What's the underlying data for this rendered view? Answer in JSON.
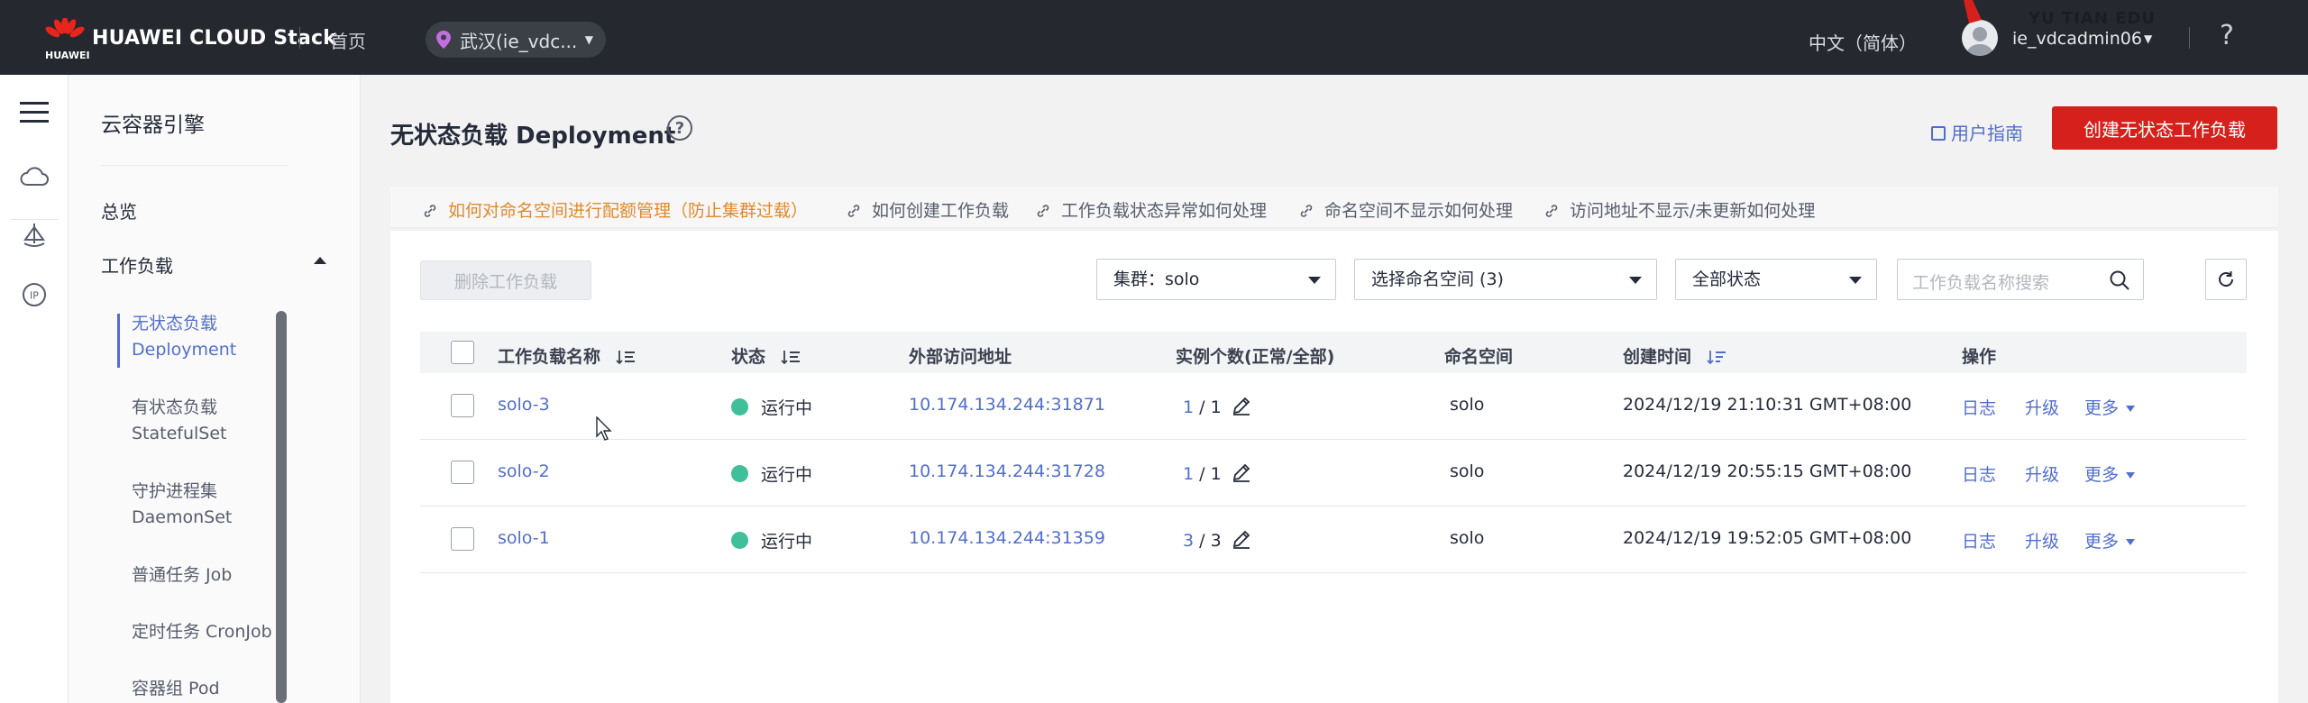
{
  "header": {
    "brand": "HUAWEI CLOUD Stack",
    "brand_sub": "HUAWEI",
    "home": "首页",
    "region": "武汉(ie_vdc...",
    "language": "中文（简体）",
    "username": "ie_vdcadmin06",
    "help": "?",
    "watermark": "YU TIAN EDU",
    "colors": {
      "bar": "#25282e",
      "accent": "#d5201b"
    }
  },
  "rail": {
    "icons": [
      "menu-icon",
      "cloud-icon",
      "ship-icon",
      "ip-icon"
    ],
    "ip_label": "IP"
  },
  "subnav": {
    "title": "云容器引擎",
    "overview": "总览",
    "workloads": "工作负载",
    "items": [
      {
        "label": "无状态负载",
        "sub": "Deployment",
        "active": true
      },
      {
        "label": "有状态负载",
        "sub": "StatefulSet"
      },
      {
        "label": "守护进程集",
        "sub": "DaemonSet"
      },
      {
        "label": "普通任务 Job",
        "sub": ""
      },
      {
        "label": "定时任务 CronJob",
        "sub": ""
      },
      {
        "label": "容器组 Pod",
        "sub": ""
      }
    ]
  },
  "page": {
    "title": "无状态负载 Deployment",
    "user_guide": "用户指南",
    "create_button": "创建无状态工作负载"
  },
  "tips": [
    "如何对命名空间进行配额管理（防止集群过载）",
    "如何创建工作负载",
    "工作负载状态异常如何处理",
    "命名空间不显示如何处理",
    "访问地址不显示/未更新如何处理"
  ],
  "toolbar": {
    "delete_button": "删除工作负载",
    "cluster_select": "集群：solo",
    "namespace_select": "选择命名空间 (3)",
    "status_select": "全部状态",
    "search_placeholder": "工作负载名称搜索"
  },
  "table": {
    "columns": [
      "工作负载名称",
      "状态",
      "外部访问地址",
      "实例个数(正常/全部)",
      "命名空间",
      "创建时间",
      "操作"
    ],
    "rows": [
      {
        "name": "solo-3",
        "status": "运行中",
        "address": "10.174.134.244:31871",
        "ready": "1",
        "total": "/ 1",
        "namespace": "solo",
        "created": "2024/12/19 21:10:31 GMT+08:00"
      },
      {
        "name": "solo-2",
        "status": "运行中",
        "address": "10.174.134.244:31728",
        "ready": "1",
        "total": "/ 1",
        "namespace": "solo",
        "created": "2024/12/19 20:55:15 GMT+08:00"
      },
      {
        "name": "solo-1",
        "status": "运行中",
        "address": "10.174.134.244:31359",
        "ready": "3",
        "total": "/ 3",
        "namespace": "solo",
        "created": "2024/12/19 19:52:05 GMT+08:00"
      }
    ],
    "actions": {
      "log": "日志",
      "upgrade": "升级",
      "more": "更多"
    }
  }
}
